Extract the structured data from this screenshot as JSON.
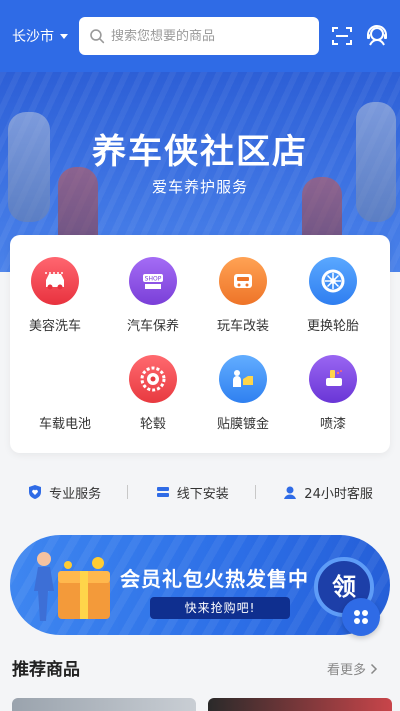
{
  "header": {
    "city": "长沙市",
    "search_placeholder": "搜索您想要的商品",
    "scan_icon": "scan-icon",
    "service_icon": "customer-service-icon"
  },
  "banner": {
    "title": "养车侠社区店",
    "subtitle": "爱车养护服务"
  },
  "services": [
    {
      "label": "美容洗车",
      "icon": "car-wash-icon",
      "color": "#f0474f"
    },
    {
      "label": "汽车保养",
      "icon": "shop-icon",
      "color": "#8a4fe0"
    },
    {
      "label": "玩车改装",
      "icon": "car-mod-icon",
      "color": "#f08a3a"
    },
    {
      "label": "更换轮胎",
      "icon": "tire-icon",
      "color": "#3b8ff0"
    },
    {
      "label": "车载电池",
      "icon": "battery-icon",
      "color": "#ffffff"
    },
    {
      "label": "轮毂",
      "icon": "wheel-hub-icon",
      "color": "#f0474f"
    },
    {
      "label": "贴膜镀金",
      "icon": "film-icon",
      "color": "#3b8ff0"
    },
    {
      "label": "喷漆",
      "icon": "spray-paint-icon",
      "color": "#7a4fe0"
    }
  ],
  "features": [
    {
      "label": "专业服务",
      "icon": "shield-heart-icon"
    },
    {
      "label": "线下安装",
      "icon": "install-icon"
    },
    {
      "label": "24小时客服",
      "icon": "support-agent-icon"
    }
  ],
  "promo": {
    "title": "会员礼包火热发售中",
    "button": "快来抢购吧!",
    "badge": "领"
  },
  "recommend": {
    "title": "推荐商品",
    "more": "看更多"
  },
  "colors": {
    "brand": "#2f6be6",
    "background": "#f4f5f7"
  }
}
